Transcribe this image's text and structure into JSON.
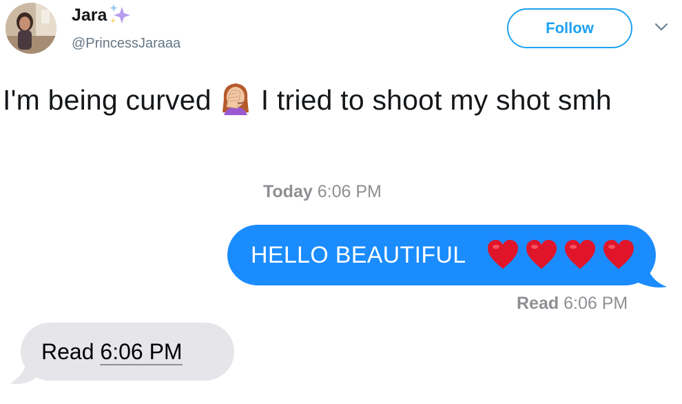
{
  "tweet": {
    "display_name": "Jara",
    "name_emoji": "sparkles-icon",
    "handle": "@PrincessJaraaa",
    "follow_label": "Follow",
    "menu_icon": "chevron-down-icon",
    "text_part1": "I'm being curved",
    "text_emoji": "woman-facepalming-icon",
    "text_part2": "I tried to shoot my shot smh"
  },
  "messages": {
    "header_day": "Today",
    "header_time": "6:06 PM",
    "sent": {
      "text": "HELLO BEAUTIFUL",
      "emoji": [
        "red-heart-icon",
        "red-heart-icon",
        "red-heart-icon",
        "red-heart-icon"
      ],
      "receipt_label": "Read",
      "receipt_time": "6:06 PM"
    },
    "received": {
      "label": "Read",
      "time": "6:06 PM"
    }
  },
  "colors": {
    "twitter_blue": "#1da1f2",
    "imessage_blue": "#1b8cfd",
    "received_gray": "#e5e5ea",
    "meta_gray": "#8e8e93",
    "heart_red": "#e0152a"
  }
}
